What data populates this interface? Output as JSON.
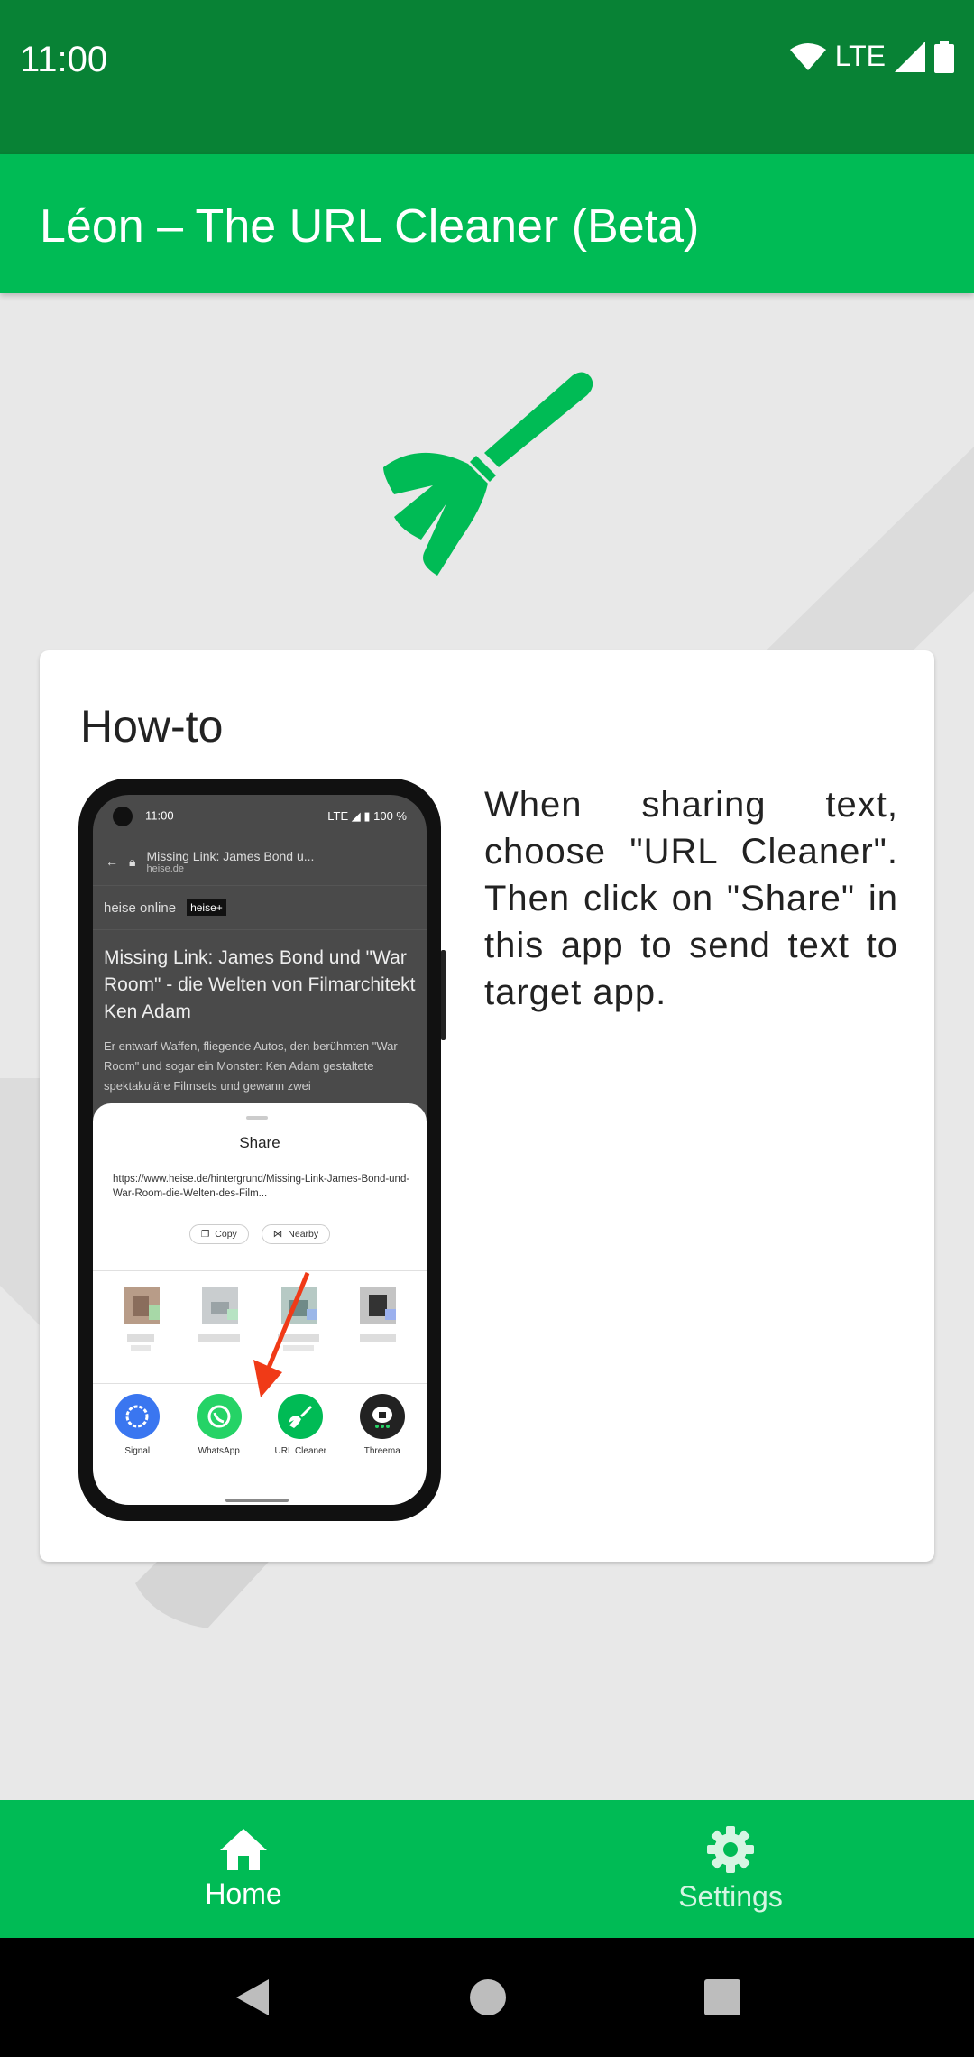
{
  "status_bar": {
    "time": "11:00",
    "network": "LTE"
  },
  "app_bar": {
    "title": "Léon – The URL Cleaner (Beta)"
  },
  "hero": {
    "icon": "broom-icon"
  },
  "card": {
    "title": "How-to",
    "text": "When sharing text, choose \"URL Cleaner\". Then click on \"Share\" in this app to send text to target app."
  },
  "phone": {
    "status_time": "11:00",
    "status_right": "LTE ◢ ▮ 100 %",
    "url_title": "Missing Link: James Bond u...",
    "url_host": "heise.de",
    "site_name": "heise online",
    "site_badge": "heise+",
    "headline": "Missing Link: James Bond und \"War Room\" - die Welten von Filmarchitekt Ken Adam",
    "body": "Er entwarf Waffen, fliegende Autos, den berühmten \"War Room\" und sogar ein Monster: Ken Adam gestaltete spektakuläre Filmsets und gewann zwei",
    "share": {
      "title": "Share",
      "url": "https://www.heise.de/hintergrund/Missing-Link-James-Bond-und-War-Room-die-Welten-des-Film...",
      "copy": "Copy",
      "nearby": "Nearby",
      "apps": [
        {
          "label": "Signal",
          "color": "#3a76f0"
        },
        {
          "label": "WhatsApp",
          "color": "#25d366"
        },
        {
          "label": "URL Cleaner",
          "color": "#00bb55"
        },
        {
          "label": "Threema",
          "color": "#222222"
        }
      ]
    }
  },
  "bottom_nav": {
    "items": [
      {
        "label": "Home",
        "icon": "home-icon",
        "active": true
      },
      {
        "label": "Settings",
        "icon": "gear-icon",
        "active": false
      }
    ]
  },
  "colors": {
    "primary": "#00bb55",
    "primary_dark": "#088235",
    "accent_arrow": "#f03a17"
  }
}
